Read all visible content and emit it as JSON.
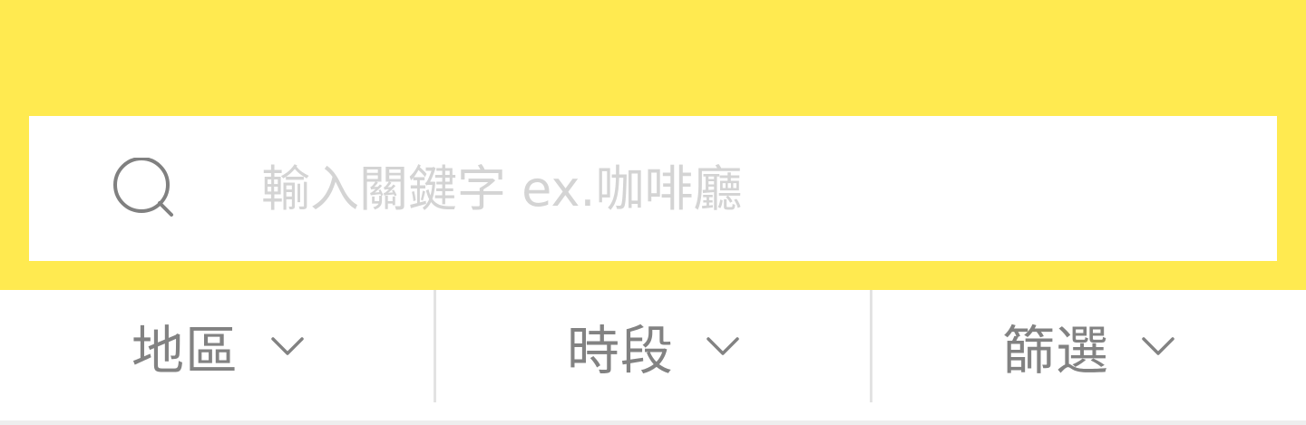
{
  "theme": {
    "header_color": "#FFEA50",
    "label_color": "#828282",
    "placeholder_color": "#d4d4d4"
  },
  "search": {
    "icon": "search-icon",
    "placeholder": "輸入關鍵字 ex.咖啡廳",
    "value": ""
  },
  "filters": [
    {
      "label": "地區",
      "icon": "chevron-down-icon"
    },
    {
      "label": "時段",
      "icon": "chevron-down-icon"
    },
    {
      "label": "篩選",
      "icon": "chevron-down-icon"
    }
  ]
}
